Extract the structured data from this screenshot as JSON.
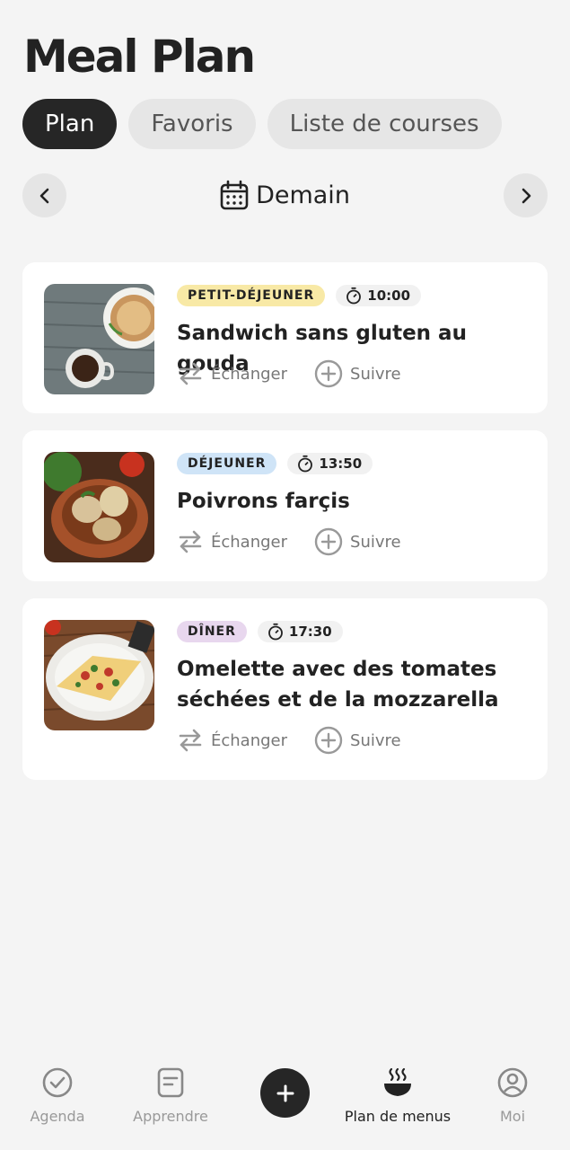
{
  "header": {
    "title": "Meal Plan"
  },
  "tabs": [
    {
      "label": "Plan",
      "active": true
    },
    {
      "label": "Favoris",
      "active": false
    },
    {
      "label": "Liste de courses",
      "active": false
    }
  ],
  "date_nav": {
    "label": "Demain",
    "icon": "calendar-icon",
    "prev_icon": "chevron-left-icon",
    "next_icon": "chevron-right-icon"
  },
  "meals": [
    {
      "category": "PETIT-DÉJEUNER",
      "time": "10:00",
      "name": "Sandwich sans gluten au gouda",
      "swap_label": "Échanger",
      "track_label": "Suivre"
    },
    {
      "category": "DÉJEUNER",
      "time": "13:50",
      "name": "Poivrons farçis",
      "swap_label": "Échanger",
      "track_label": "Suivre"
    },
    {
      "category": "DÎNER",
      "time": "17:30",
      "name": "Omelette avec des tomates séchées et de la mozzarella",
      "swap_label": "Échanger",
      "track_label": "Suivre"
    }
  ],
  "bottom_nav": [
    {
      "label": "Agenda",
      "icon": "check-circle-icon",
      "active": false
    },
    {
      "label": "Apprendre",
      "icon": "document-icon",
      "active": false
    },
    {
      "label": "",
      "icon": "plus-icon",
      "active": false
    },
    {
      "label": "Plan de menus",
      "icon": "bowl-icon",
      "active": true
    },
    {
      "label": "Moi",
      "icon": "user-icon",
      "active": false
    }
  ],
  "colors": {
    "badge_breakfast": "#f8e9a6",
    "badge_lunch": "#cfe4f7",
    "badge_dinner": "#e8d7ee",
    "active_tab": "#262626",
    "background": "#f4f4f4"
  }
}
